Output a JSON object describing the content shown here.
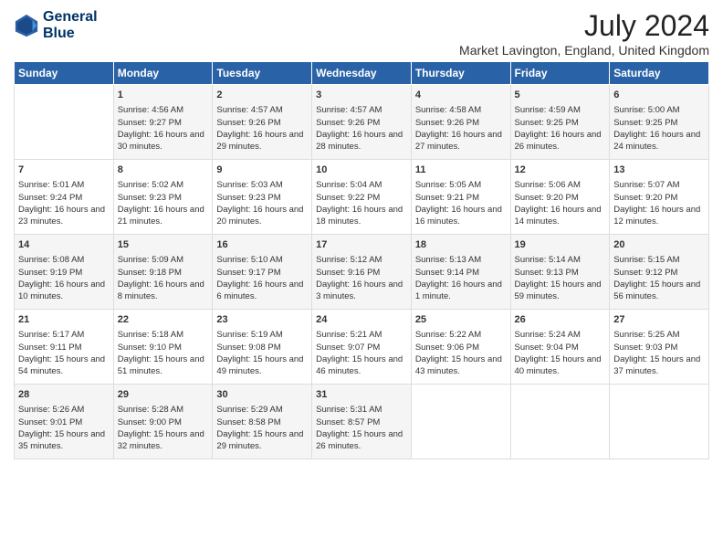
{
  "logo": {
    "line1": "General",
    "line2": "Blue"
  },
  "title": "July 2024",
  "location": "Market Lavington, England, United Kingdom",
  "days_of_week": [
    "Sunday",
    "Monday",
    "Tuesday",
    "Wednesday",
    "Thursday",
    "Friday",
    "Saturday"
  ],
  "weeks": [
    [
      {
        "day": "",
        "sunrise": "",
        "sunset": "",
        "daylight": ""
      },
      {
        "day": "1",
        "sunrise": "Sunrise: 4:56 AM",
        "sunset": "Sunset: 9:27 PM",
        "daylight": "Daylight: 16 hours and 30 minutes."
      },
      {
        "day": "2",
        "sunrise": "Sunrise: 4:57 AM",
        "sunset": "Sunset: 9:26 PM",
        "daylight": "Daylight: 16 hours and 29 minutes."
      },
      {
        "day": "3",
        "sunrise": "Sunrise: 4:57 AM",
        "sunset": "Sunset: 9:26 PM",
        "daylight": "Daylight: 16 hours and 28 minutes."
      },
      {
        "day": "4",
        "sunrise": "Sunrise: 4:58 AM",
        "sunset": "Sunset: 9:26 PM",
        "daylight": "Daylight: 16 hours and 27 minutes."
      },
      {
        "day": "5",
        "sunrise": "Sunrise: 4:59 AM",
        "sunset": "Sunset: 9:25 PM",
        "daylight": "Daylight: 16 hours and 26 minutes."
      },
      {
        "day": "6",
        "sunrise": "Sunrise: 5:00 AM",
        "sunset": "Sunset: 9:25 PM",
        "daylight": "Daylight: 16 hours and 24 minutes."
      }
    ],
    [
      {
        "day": "7",
        "sunrise": "Sunrise: 5:01 AM",
        "sunset": "Sunset: 9:24 PM",
        "daylight": "Daylight: 16 hours and 23 minutes."
      },
      {
        "day": "8",
        "sunrise": "Sunrise: 5:02 AM",
        "sunset": "Sunset: 9:23 PM",
        "daylight": "Daylight: 16 hours and 21 minutes."
      },
      {
        "day": "9",
        "sunrise": "Sunrise: 5:03 AM",
        "sunset": "Sunset: 9:23 PM",
        "daylight": "Daylight: 16 hours and 20 minutes."
      },
      {
        "day": "10",
        "sunrise": "Sunrise: 5:04 AM",
        "sunset": "Sunset: 9:22 PM",
        "daylight": "Daylight: 16 hours and 18 minutes."
      },
      {
        "day": "11",
        "sunrise": "Sunrise: 5:05 AM",
        "sunset": "Sunset: 9:21 PM",
        "daylight": "Daylight: 16 hours and 16 minutes."
      },
      {
        "day": "12",
        "sunrise": "Sunrise: 5:06 AM",
        "sunset": "Sunset: 9:20 PM",
        "daylight": "Daylight: 16 hours and 14 minutes."
      },
      {
        "day": "13",
        "sunrise": "Sunrise: 5:07 AM",
        "sunset": "Sunset: 9:20 PM",
        "daylight": "Daylight: 16 hours and 12 minutes."
      }
    ],
    [
      {
        "day": "14",
        "sunrise": "Sunrise: 5:08 AM",
        "sunset": "Sunset: 9:19 PM",
        "daylight": "Daylight: 16 hours and 10 minutes."
      },
      {
        "day": "15",
        "sunrise": "Sunrise: 5:09 AM",
        "sunset": "Sunset: 9:18 PM",
        "daylight": "Daylight: 16 hours and 8 minutes."
      },
      {
        "day": "16",
        "sunrise": "Sunrise: 5:10 AM",
        "sunset": "Sunset: 9:17 PM",
        "daylight": "Daylight: 16 hours and 6 minutes."
      },
      {
        "day": "17",
        "sunrise": "Sunrise: 5:12 AM",
        "sunset": "Sunset: 9:16 PM",
        "daylight": "Daylight: 16 hours and 3 minutes."
      },
      {
        "day": "18",
        "sunrise": "Sunrise: 5:13 AM",
        "sunset": "Sunset: 9:14 PM",
        "daylight": "Daylight: 16 hours and 1 minute."
      },
      {
        "day": "19",
        "sunrise": "Sunrise: 5:14 AM",
        "sunset": "Sunset: 9:13 PM",
        "daylight": "Daylight: 15 hours and 59 minutes."
      },
      {
        "day": "20",
        "sunrise": "Sunrise: 5:15 AM",
        "sunset": "Sunset: 9:12 PM",
        "daylight": "Daylight: 15 hours and 56 minutes."
      }
    ],
    [
      {
        "day": "21",
        "sunrise": "Sunrise: 5:17 AM",
        "sunset": "Sunset: 9:11 PM",
        "daylight": "Daylight: 15 hours and 54 minutes."
      },
      {
        "day": "22",
        "sunrise": "Sunrise: 5:18 AM",
        "sunset": "Sunset: 9:10 PM",
        "daylight": "Daylight: 15 hours and 51 minutes."
      },
      {
        "day": "23",
        "sunrise": "Sunrise: 5:19 AM",
        "sunset": "Sunset: 9:08 PM",
        "daylight": "Daylight: 15 hours and 49 minutes."
      },
      {
        "day": "24",
        "sunrise": "Sunrise: 5:21 AM",
        "sunset": "Sunset: 9:07 PM",
        "daylight": "Daylight: 15 hours and 46 minutes."
      },
      {
        "day": "25",
        "sunrise": "Sunrise: 5:22 AM",
        "sunset": "Sunset: 9:06 PM",
        "daylight": "Daylight: 15 hours and 43 minutes."
      },
      {
        "day": "26",
        "sunrise": "Sunrise: 5:24 AM",
        "sunset": "Sunset: 9:04 PM",
        "daylight": "Daylight: 15 hours and 40 minutes."
      },
      {
        "day": "27",
        "sunrise": "Sunrise: 5:25 AM",
        "sunset": "Sunset: 9:03 PM",
        "daylight": "Daylight: 15 hours and 37 minutes."
      }
    ],
    [
      {
        "day": "28",
        "sunrise": "Sunrise: 5:26 AM",
        "sunset": "Sunset: 9:01 PM",
        "daylight": "Daylight: 15 hours and 35 minutes."
      },
      {
        "day": "29",
        "sunrise": "Sunrise: 5:28 AM",
        "sunset": "Sunset: 9:00 PM",
        "daylight": "Daylight: 15 hours and 32 minutes."
      },
      {
        "day": "30",
        "sunrise": "Sunrise: 5:29 AM",
        "sunset": "Sunset: 8:58 PM",
        "daylight": "Daylight: 15 hours and 29 minutes."
      },
      {
        "day": "31",
        "sunrise": "Sunrise: 5:31 AM",
        "sunset": "Sunset: 8:57 PM",
        "daylight": "Daylight: 15 hours and 26 minutes."
      },
      {
        "day": "",
        "sunrise": "",
        "sunset": "",
        "daylight": ""
      },
      {
        "day": "",
        "sunrise": "",
        "sunset": "",
        "daylight": ""
      },
      {
        "day": "",
        "sunrise": "",
        "sunset": "",
        "daylight": ""
      }
    ]
  ]
}
